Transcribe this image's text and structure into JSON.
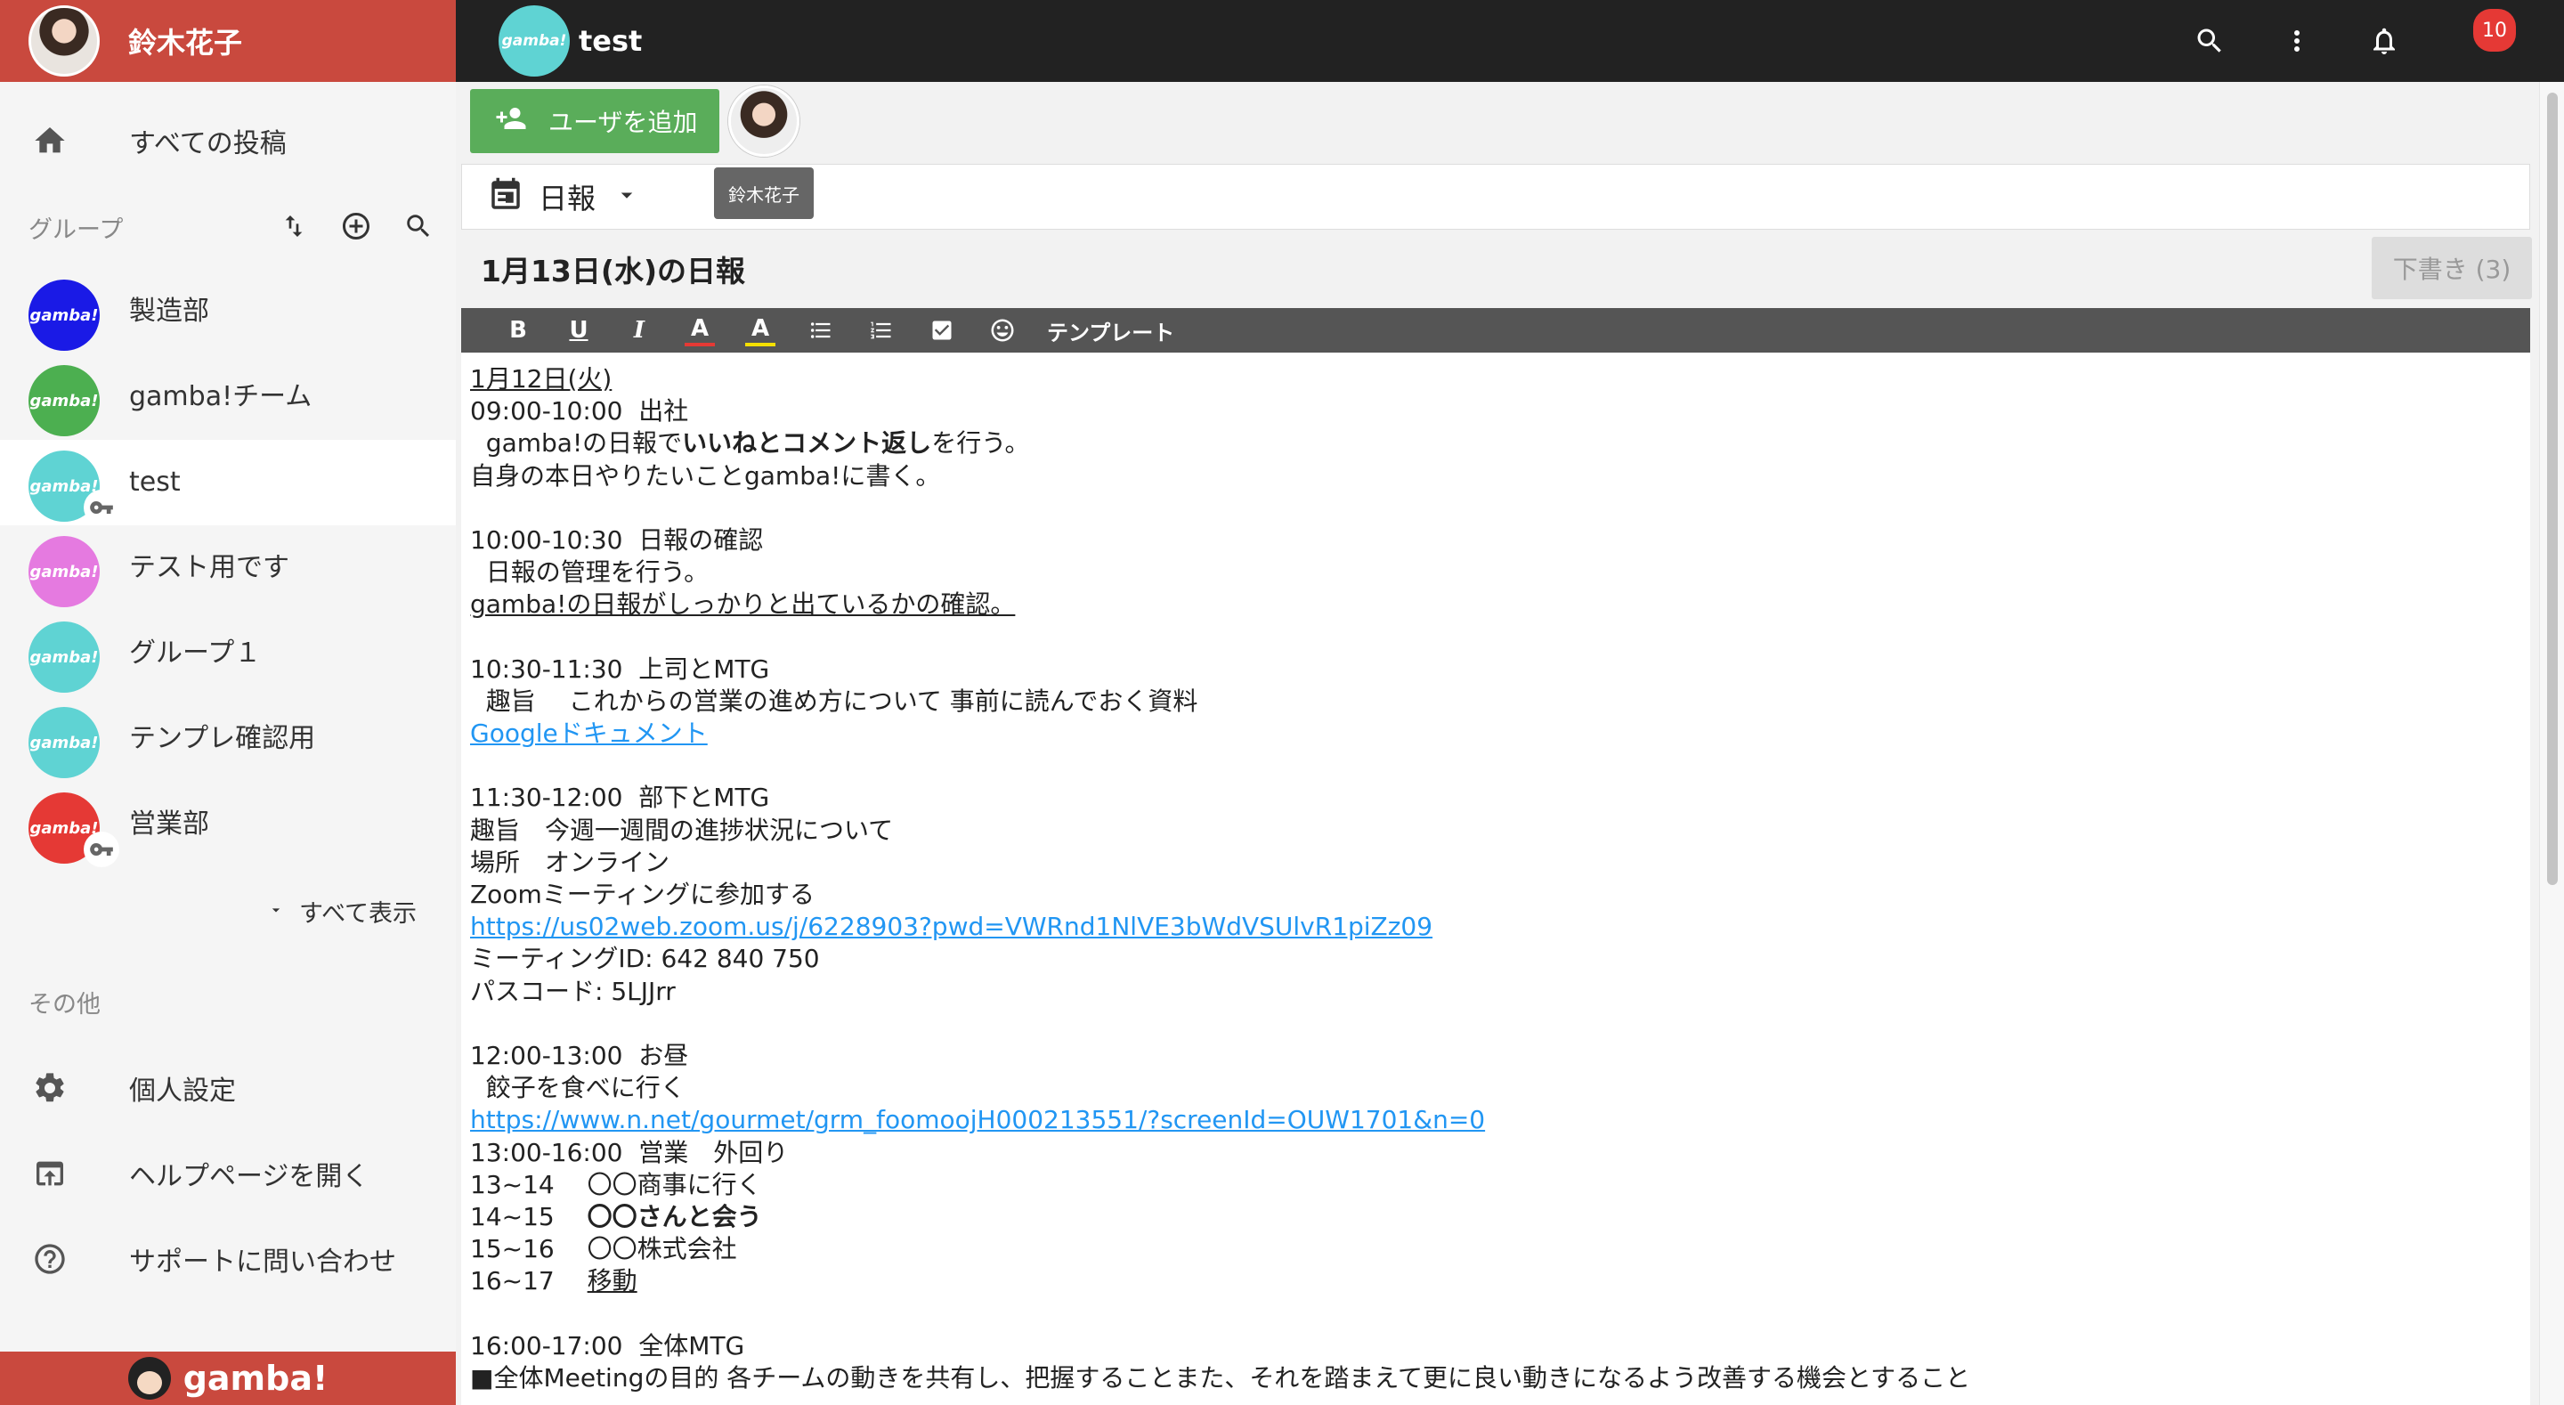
{
  "user": {
    "name": "鈴木花子"
  },
  "topbar": {
    "group_title": "test",
    "group_logo": "gamba!",
    "badge_count": "10"
  },
  "nav": {
    "all_posts": "すべての投稿"
  },
  "groups": {
    "section_label": "グループ",
    "items": [
      {
        "name": "製造部",
        "logo": "gamba!",
        "color": "#1a1ae6"
      },
      {
        "name": "gamba!チーム",
        "logo": "gamba!",
        "color": "#4caf50"
      },
      {
        "name": "test",
        "logo": "gamba!",
        "color": "#5fd3d3"
      },
      {
        "name": "テスト用です",
        "logo": "gamba!",
        "color": "#e57ae0"
      },
      {
        "name": "グループ１",
        "logo": "gamba!",
        "color": "#5fd3d3"
      },
      {
        "name": "テンプレ確認用",
        "logo": "gamba!",
        "color": "#5fd3d3"
      },
      {
        "name": "営業部",
        "logo": "gamba!",
        "color": "#e53935"
      }
    ],
    "show_all": "すべて表示"
  },
  "other": {
    "section_label": "その他",
    "settings": "個人設定",
    "help": "ヘルプページを開く",
    "support": "サポートに問い合わせ"
  },
  "footer": {
    "brand": "gamba!"
  },
  "main": {
    "add_user": "ユーザを追加",
    "tooltip": "鈴木花子",
    "template_label": "日報",
    "day_title": "1月13日(水)の日報",
    "draft_button": "下書き (3)",
    "toolbar": {
      "template": "テンプレート"
    }
  },
  "editor_lines": [
    "1月12日(火)",
    "09:00-10:00  出社",
    "  gamba!の日報で",
    "いいねとコメント返し",
    "を行う。",
    "自身の本日やりたいことgamba!に書く。",
    "",
    "10:00-10:30  日報の確認",
    "  日報の管理を行う。",
    "gamba!の日報がしっかりと出ているかの確認。",
    "",
    "10:30-11:30  上司とMTG",
    "  趣旨　 これからの営業の進め方について 事前に読んでおく資料",
    "Googleドキュメント",
    "",
    "11:30-12:00  部下とMTG",
    "趣旨　今週一週間の進捗状況について",
    "場所　オンライン",
    "Zoomミーティングに参加する",
    "https://us02web.zoom.us/j/6228903?pwd=VWRnd1NlVE3bWdVSUlvR1piZz09",
    "ミーティングID: 642 840 750",
    "パスコード: 5LJJrr",
    "",
    "12:00-13:00  お昼",
    "  餃子を食べに行く",
    "https://www.n.net/gourmet/grm_foomoojH000213551/?screenId=OUW1701&n=0",
    "13:00-16:00  営業　外回り",
    "13~14　 〇〇商事に行く",
    "14~15　 ",
    "〇〇さんと会う",
    "15~16　 〇〇株式会社",
    "16~17　 ",
    "移動",
    "",
    "16:00-17:00  全体MTG",
    "■全体Meetingの目的 各チームの動きを共有し、把握することまた、それを踏まえて更に良い動きになるよう改善する機会とすること"
  ]
}
